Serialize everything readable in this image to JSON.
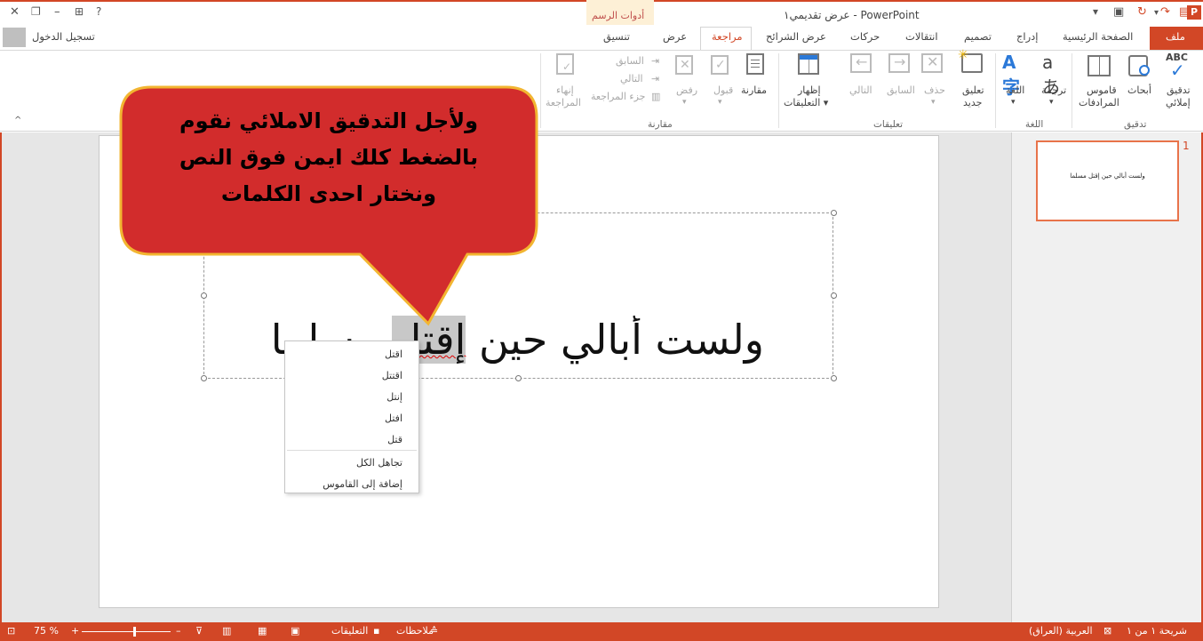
{
  "titlebar": {
    "title": "عرض تقديمي١ - PowerPoint",
    "context_tab_group": "أدوات الرسم",
    "app_icon": "P"
  },
  "tabs": {
    "file": "ملف",
    "home": "الصفحة الرئيسية",
    "insert": "إدراج",
    "design": "تصميم",
    "transitions": "انتقالات",
    "animations": "حركات",
    "slideshow": "عرض الشرائح",
    "review": "مراجعة",
    "view": "عرض",
    "format": "تنسيق",
    "signin": "تسجيل الدخول"
  },
  "ribbon": {
    "spelling": "تدقيق",
    "spelling2": "إملائي",
    "research": "أبحاث",
    "thesaurus": "قاموس",
    "thesaurus2": "المرادفات",
    "group_proofing": "تدقيق",
    "translate": "ترجمة",
    "language": "اللغة",
    "group_language": "اللغة",
    "new_comment": "تعليق",
    "new_comment2": "جديد",
    "delete": "حذف",
    "previous": "السابق",
    "next": "التالي",
    "show_comments": "إظهار",
    "show_comments2": "التعليقات ▾",
    "group_comments": "تعليقات",
    "compare": "مقارنة",
    "accept": "قبول",
    "reject": "رفض",
    "prev_change": "السابق",
    "next_change": "التالي",
    "reviewing_pane": "جزء المراجعة",
    "end_review": "إنهاء",
    "end_review2": "المراجعة",
    "group_compare": "مقارنة"
  },
  "slide": {
    "text_before": "ولست أبالي حين ",
    "highlighted_word": "إقتل",
    "text_after": " مسلما",
    "number": "1",
    "thumb_text": "ولست أبالي حين إقتل مسلما"
  },
  "context_menu": {
    "items": [
      "اقتل",
      "اقتتل",
      "إنتل",
      "افتل",
      "قتل"
    ],
    "ignore_all": "تجاهل الكل",
    "add_to_dictionary": "إضافة إلى القاموس"
  },
  "callout": {
    "line1": "ولأجل التدقيق الاملائي نقوم",
    "line2": "بالضغط كلك ايمن فوق النص",
    "line3": "ونختار احدى الكلمات"
  },
  "status": {
    "slide_info": "شريحة ١ من ١",
    "language": "العربية (العراق)",
    "notes": "ملاحظات",
    "comments": "التعليقات",
    "zoom": "75 %"
  },
  "colors": {
    "accent": "#d24726",
    "callout_fill": "#d22c2c",
    "callout_border": "#f2b531"
  }
}
